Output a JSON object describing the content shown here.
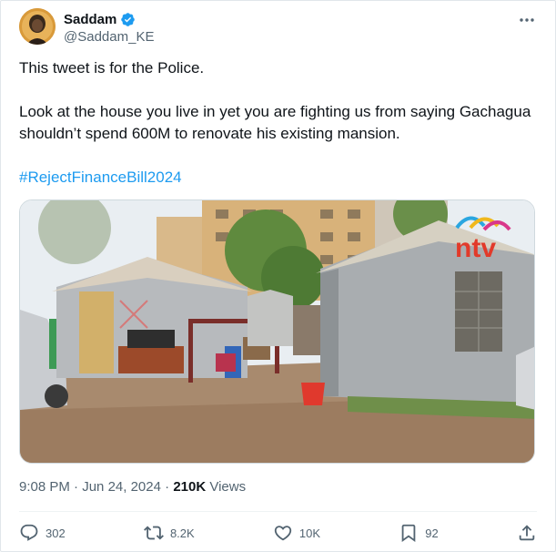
{
  "author": {
    "display_name": "Saddam",
    "handle": "@Saddam_KE",
    "verified": true,
    "avatar_icon": "avatar-icon"
  },
  "tweet": {
    "line1": "This tweet is for the Police.",
    "line2": "Look at the house you live in yet you are fighting us from saying Gachagua shouldn’t spend 600M to renovate his existing mansion.",
    "hashtag": "#RejectFinanceBill2024"
  },
  "media": {
    "watermark": "ntv"
  },
  "meta": {
    "time": "9:08 PM",
    "sep1": " · ",
    "date": "Jun 24, 2024",
    "sep2": " · ",
    "views_count": "210K",
    "views_label": " Views"
  },
  "actions": {
    "replies": "302",
    "reposts": "8.2K",
    "likes": "10K",
    "bookmarks": "92"
  },
  "colors": {
    "accent": "#1d9bf0",
    "muted": "#536471",
    "text": "#0f1419"
  }
}
